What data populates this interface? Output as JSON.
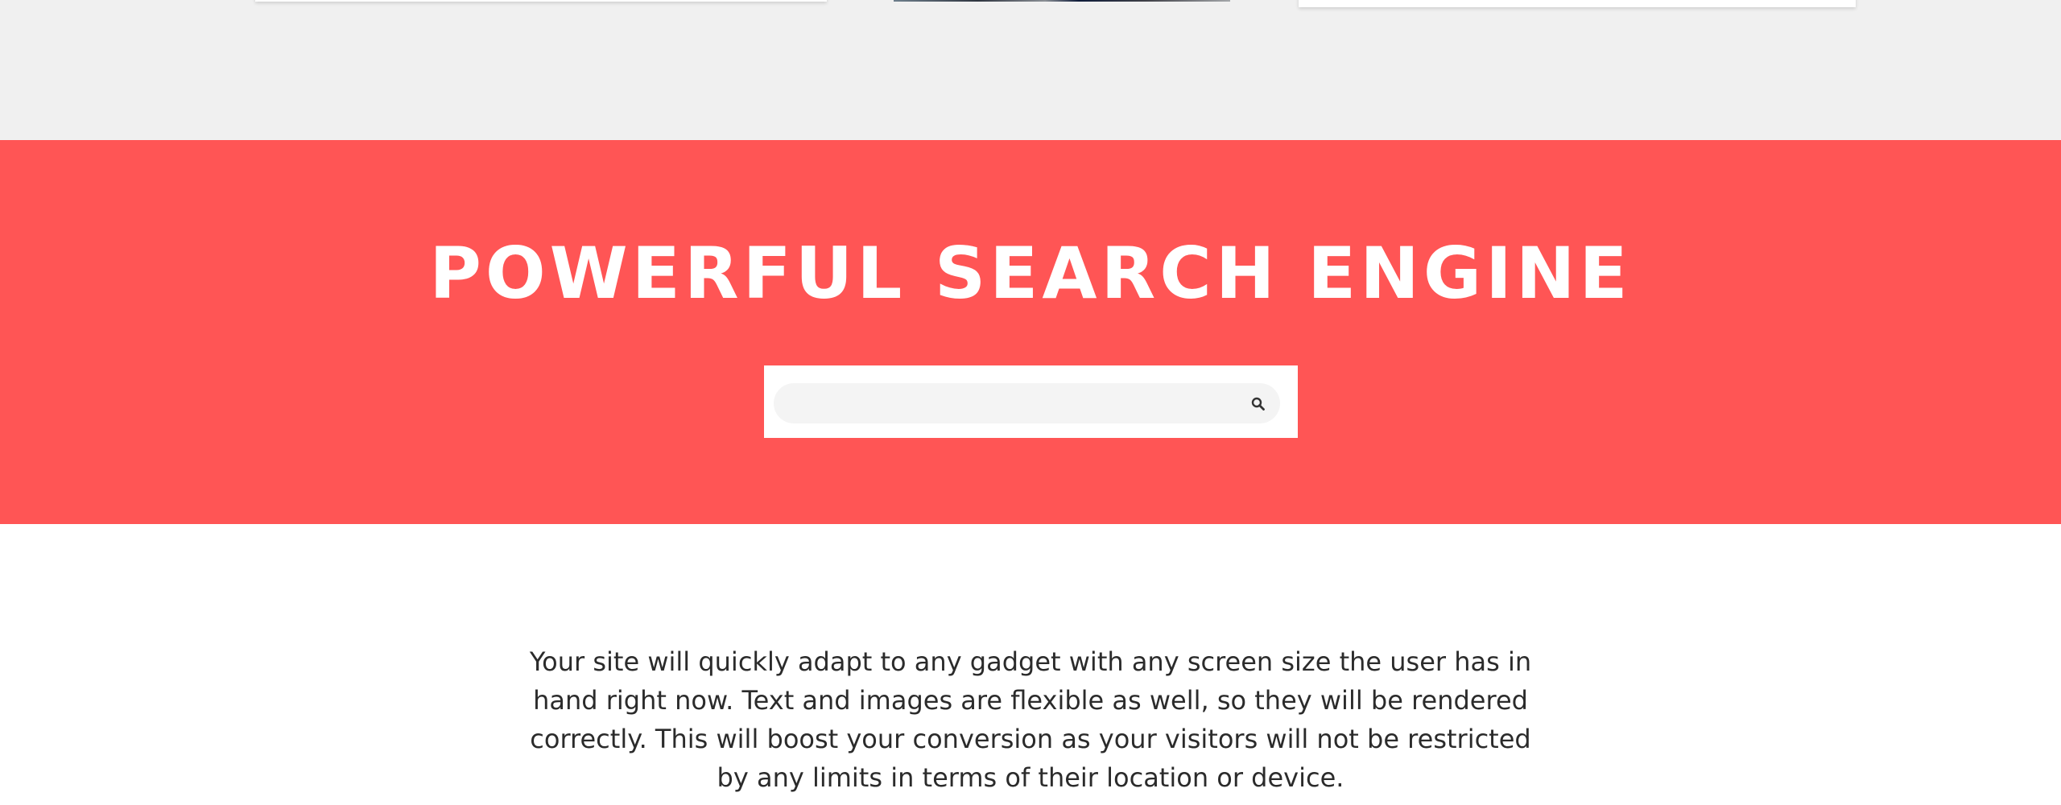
{
  "search_section": {
    "heading": "POWERFUL SEARCH ENGINE",
    "input_value": "",
    "input_placeholder": "",
    "search_icon": "magnifier-icon",
    "band_color": "#ff5555"
  },
  "description": {
    "text": "Your site will quickly adapt to any gadget with any screen size the user has in hand right now. Text and images are flexible as well, so they will be rendered correctly. This will boost your conversion as your visitors will not be restricted by any limits in terms of their location or device."
  },
  "colors": {
    "page_background": "#ffffff",
    "top_section_background": "#f0f0f0",
    "text": "#2b2b2b"
  }
}
